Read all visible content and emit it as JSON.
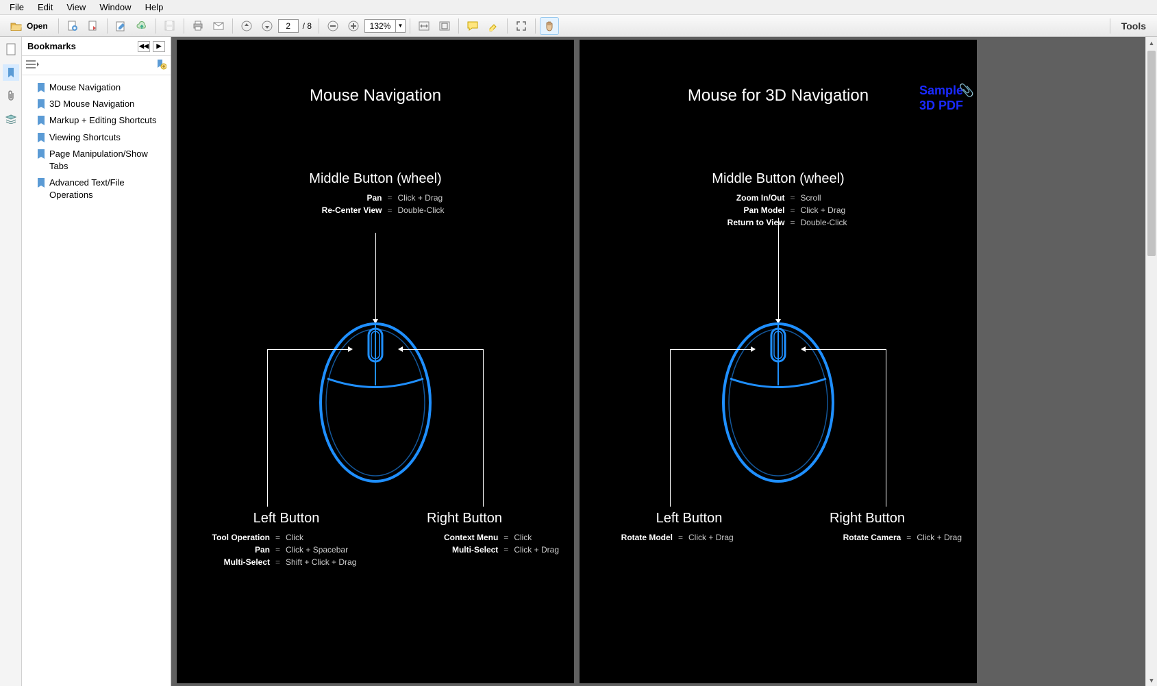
{
  "menu": [
    "File",
    "Edit",
    "View",
    "Window",
    "Help"
  ],
  "toolbar": {
    "open_label": "Open",
    "page_current": "2",
    "page_total": "/ 8",
    "zoom": "132%",
    "tools_label": "Tools"
  },
  "bookmarks": {
    "title": "Bookmarks",
    "items": [
      "Mouse Navigation",
      "3D Mouse Navigation",
      "Markup + Editing Shortcuts",
      "Viewing Shortcuts",
      "Page Manipulation/Show Tabs",
      "Advanced Text/File Operations"
    ]
  },
  "pages": [
    {
      "title": "Mouse Navigation",
      "watermark": null,
      "middle": {
        "heading": "Middle Button (wheel)",
        "rows": [
          {
            "k": "Pan",
            "v": "Click + Drag"
          },
          {
            "k": "Re-Center View",
            "v": "Double-Click"
          }
        ]
      },
      "left": {
        "heading": "Left Button",
        "rows": [
          {
            "k": "Tool Operation",
            "v": "Click"
          },
          {
            "k": "Pan",
            "v": "Click + Spacebar"
          },
          {
            "k": "Multi-Select",
            "v": "Shift + Click + Drag"
          }
        ]
      },
      "right": {
        "heading": "Right Button",
        "rows": [
          {
            "k": "Context Menu",
            "v": "Click"
          },
          {
            "k": "Multi-Select",
            "v": "Click + Drag"
          }
        ]
      }
    },
    {
      "title": "Mouse for 3D Navigation",
      "watermark": {
        "line1": "Sample",
        "line2": "3D PDF"
      },
      "middle": {
        "heading": "Middle Button (wheel)",
        "rows": [
          {
            "k": "Zoom In/Out",
            "v": "Scroll"
          },
          {
            "k": "Pan Model",
            "v": "Click + Drag"
          },
          {
            "k": "Return to View",
            "v": "Double-Click"
          }
        ]
      },
      "left": {
        "heading": "Left Button",
        "rows": [
          {
            "k": "Rotate Model",
            "v": "Click + Drag"
          }
        ]
      },
      "right": {
        "heading": "Right Button",
        "rows": [
          {
            "k": "Rotate Camera",
            "v": "Click + Drag"
          }
        ]
      }
    }
  ]
}
